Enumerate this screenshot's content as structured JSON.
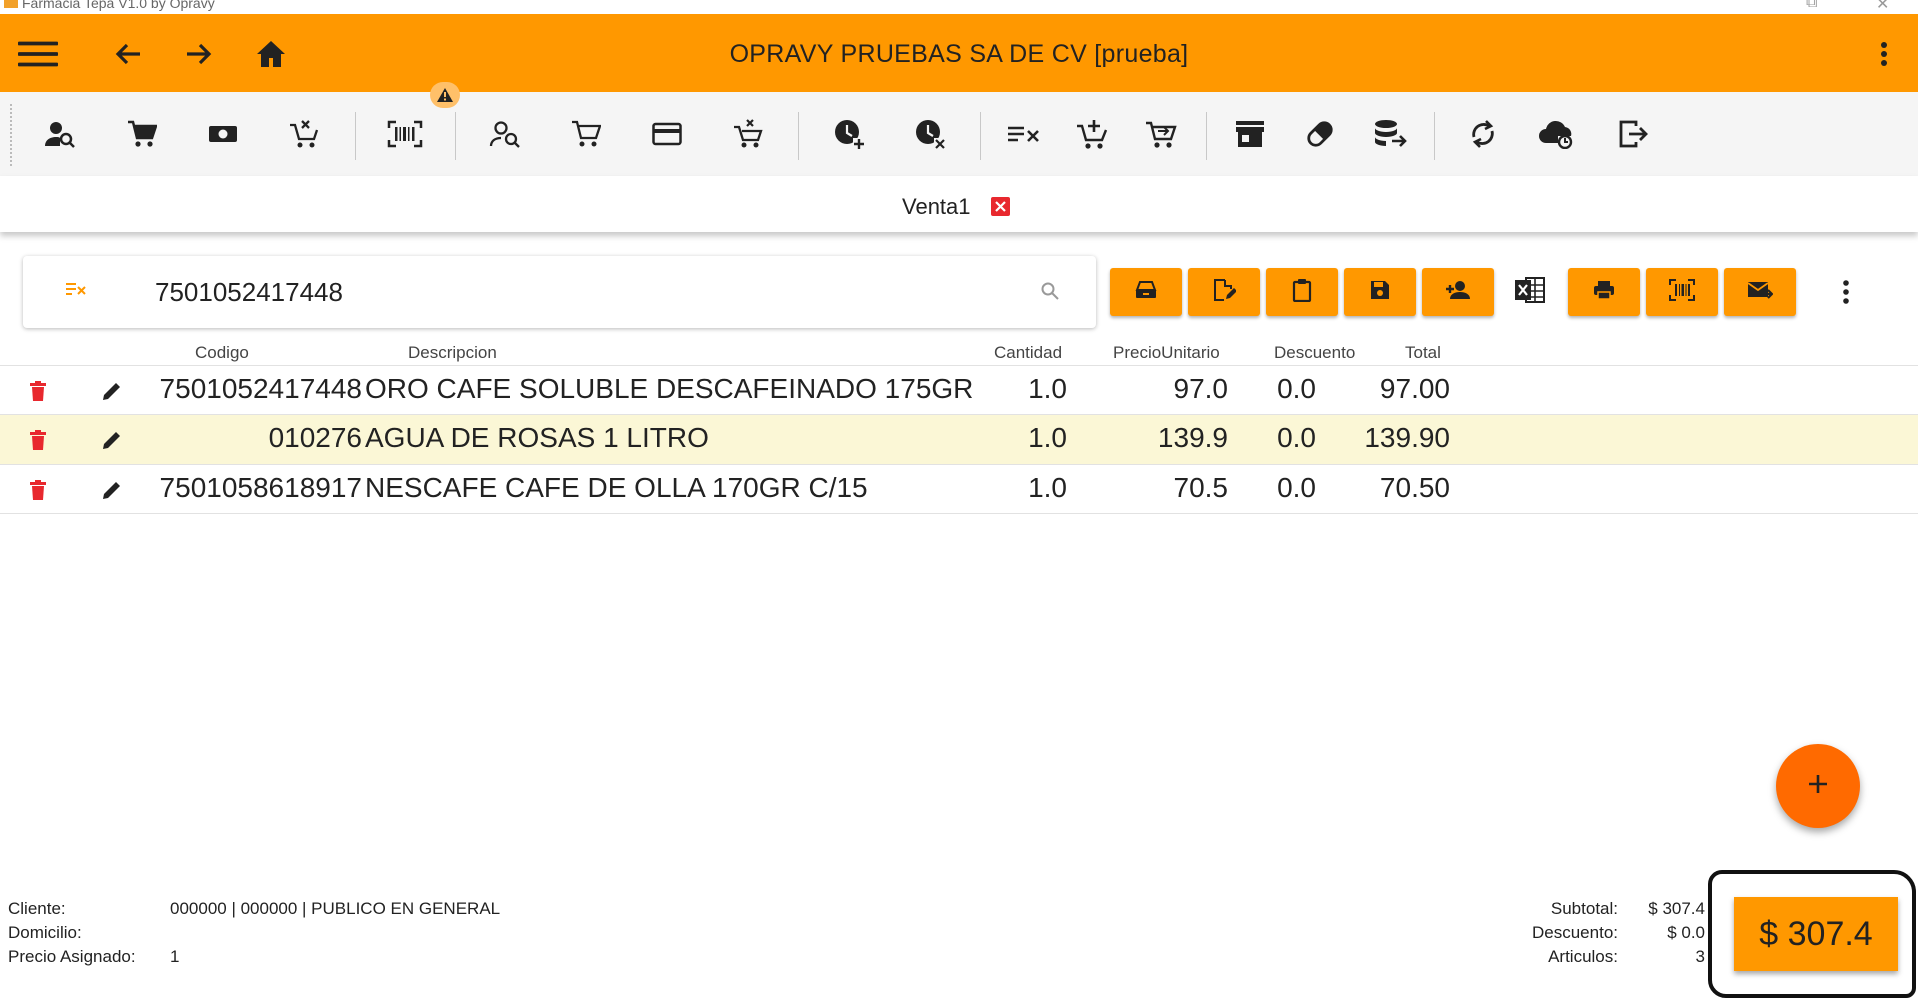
{
  "window": {
    "title": "Farmacia Tepa V1.0 by Opravy"
  },
  "appbar": {
    "title": "OPRAVY PRUEBAS SA DE CV [prueba]"
  },
  "tab": {
    "label": "Venta1"
  },
  "search": {
    "value": "7501052417448",
    "placeholder": ""
  },
  "table": {
    "columns": [
      "Codigo",
      "Descripcion",
      "Cantidad",
      "PrecioUnitario",
      "Descuento",
      "Total"
    ],
    "rows": [
      {
        "codigo": "7501052417448",
        "descripcion": "ORO CAFE SOLUBLE DESCAFEINADO 175GR",
        "cantidad": "1.0",
        "precio": "97.0",
        "descuento": "0.0",
        "total": "97.00"
      },
      {
        "codigo": "010276",
        "descripcion": "AGUA DE ROSAS 1 LITRO",
        "cantidad": "1.0",
        "precio": "139.9",
        "descuento": "0.0",
        "total": "139.90"
      },
      {
        "codigo": "7501058618917",
        "descripcion": "NESCAFE CAFE DE OLLA 170GR C/15",
        "cantidad": "1.0",
        "precio": "70.5",
        "descuento": "0.0",
        "total": "70.50"
      }
    ]
  },
  "fab": {
    "label": "+"
  },
  "footer": {
    "cliente_label": "Cliente:",
    "cliente_value": "000000 | 000000 | PUBLICO EN GENERAL",
    "domicilio_label": "Domicilio:",
    "domicilio_value": "",
    "precio_label": "Precio Asignado:",
    "precio_value": "1",
    "subtotal_label": "Subtotal:",
    "subtotal_value": "$ 307.4",
    "descuento_label": "Descuento:",
    "descuento_value": "$ 0.0",
    "articulos_label": "Articulos:",
    "articulos_value": "3",
    "total_button": "$ 307.4"
  },
  "colors": {
    "primary": "#ff9800",
    "fab": "#ff6a00",
    "delete": "#e8282e",
    "selected_row": "#fbf7d6"
  },
  "icons": {
    "appbar": [
      "menu-icon",
      "arrow-left-icon",
      "arrow-right-icon",
      "home-icon",
      "more-vert-icon"
    ],
    "toolbar": [
      "user-search-icon",
      "cart-icon",
      "cash-icon",
      "cart-remove-icon",
      "barcode-icon",
      "user-search-alt-icon",
      "cart-outline-icon",
      "credit-card-icon",
      "cart-remove-outline-icon",
      "clock-plus-icon",
      "clock-remove-icon",
      "playlist-remove-icon",
      "cart-plus-icon",
      "cart-arrow-icon",
      "store-icon",
      "pill-icon",
      "database-export-icon",
      "sync-icon",
      "cloud-sync-icon",
      "logout-icon"
    ],
    "actions": [
      "cash-register-icon",
      "file-edit-icon",
      "clipboard-icon",
      "save-icon",
      "add-user-icon",
      "excel-icon",
      "print-icon",
      "barcode-scan-icon",
      "email-send-icon",
      "more-vert-icon"
    ]
  }
}
